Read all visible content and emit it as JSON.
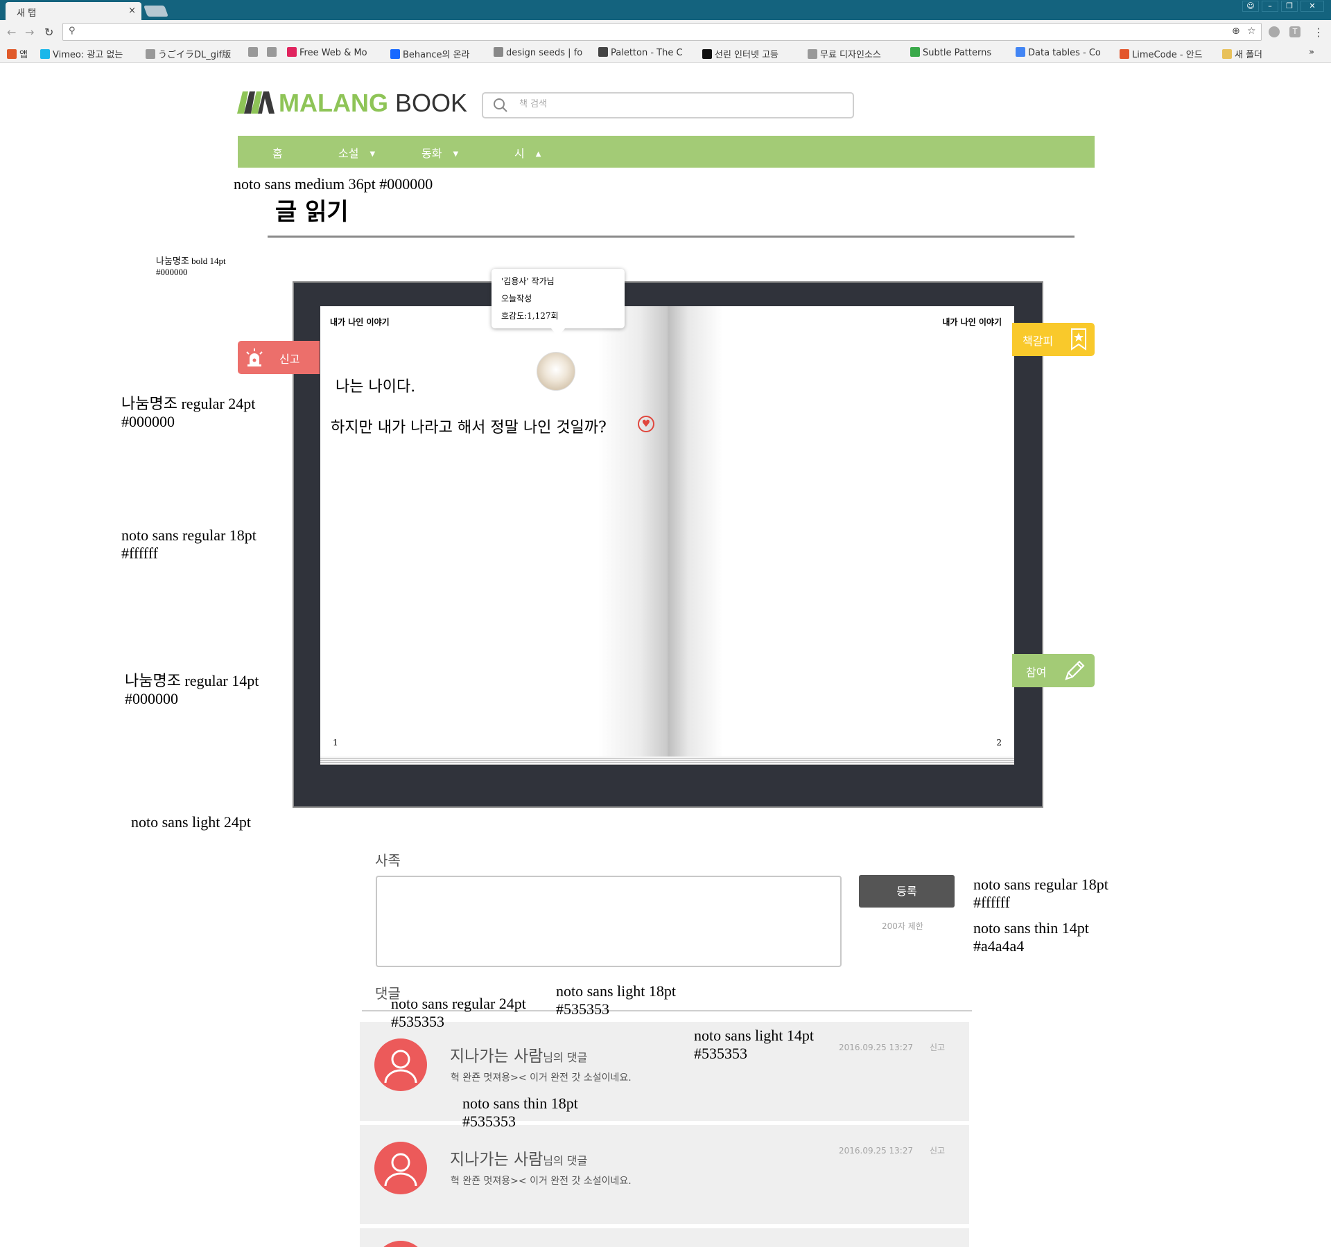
{
  "browser": {
    "tab_title": "새 탭",
    "tab_close": "×",
    "omnibox_value": "",
    "bookmarks": [
      {
        "label": "앱",
        "icon": "apps-grid-icon",
        "color": "#e05a2a"
      },
      {
        "label": "Vimeo: 광고 없는",
        "icon": "vimeo-icon",
        "color": "#1ab7ea"
      },
      {
        "label": "うごイラDL_gif版",
        "icon": "page-icon",
        "color": "#999999"
      },
      {
        "label": "",
        "icon": "page-icon",
        "color": "#999999"
      },
      {
        "label": "",
        "icon": "page-icon",
        "color": "#999999"
      },
      {
        "label": "Free Web & Mo",
        "icon": "invision-icon",
        "color": "#e0245e"
      },
      {
        "label": "Behance의 온라",
        "icon": "behance-icon",
        "color": "#1769ff"
      },
      {
        "label": "design seeds | fo",
        "icon": "design-seeds-icon",
        "color": "#888888"
      },
      {
        "label": "Paletton - The C",
        "icon": "paletton-icon",
        "color": "#444444"
      },
      {
        "label": "선린 인터넷 고등",
        "icon": "sunrin-icon",
        "color": "#111111"
      },
      {
        "label": "무료 디자인소스",
        "icon": "page-icon",
        "color": "#999999"
      },
      {
        "label": "Subtle Patterns",
        "icon": "subtle-patterns-icon",
        "color": "#3aa94a"
      },
      {
        "label": "Data tables - Co",
        "icon": "google-icon",
        "color": "#4285f4"
      },
      {
        "label": "LimeCode - 안드",
        "icon": "limecode-icon",
        "color": "#e3562c"
      },
      {
        "label": "새 폴더",
        "icon": "folder-icon",
        "color": "#e8c15a"
      }
    ],
    "more_bookmarks": "»"
  },
  "site": {
    "logo_brand": "MALANG",
    "logo_word": "BOOK",
    "search_placeholder": "책 검색",
    "nav": [
      {
        "label": "홈",
        "caret": ""
      },
      {
        "label": "소설",
        "caret": "▼"
      },
      {
        "label": "동화",
        "caret": "▼"
      },
      {
        "label": "시",
        "caret": "▲"
      }
    ],
    "colors": {
      "green": "#a3cb76",
      "red": "#ec6f6b",
      "yellow": "#f9c92b",
      "frame": "#30333b",
      "text_gray": "#535353",
      "light_gray": "#a4a4a4"
    }
  },
  "notes": {
    "n1": "noto sans medium 36pt #000000",
    "n2a": "나눔명조 bold 14pt",
    "n2b": "#000000",
    "n3a": "나눔명조 regular 24pt",
    "n3b": "#000000",
    "n4a": "noto sans regular 18pt",
    "n4b": "#ffffff",
    "n5a": "나눔명조 regular 14pt",
    "n5b": "#000000",
    "n6": "noto sans light 24pt",
    "n7a": "noto sans regular 18pt",
    "n7b": "#ffffff",
    "n8a": "noto sans thin 14pt",
    "n8b": "#a4a4a4",
    "n9a": "noto sans regular 24pt",
    "n9b": "#535353",
    "n10a": "noto sans light 18pt",
    "n10b": "#535353",
    "n11a": "noto sans light 14pt",
    "n11b": "#535353",
    "n12a": "noto sans thin 18pt",
    "n12b": "#535353"
  },
  "read": {
    "page_title": "글 읽기",
    "tooltip": {
      "line1": "'김용사' 작가님",
      "line2": "오늘작성",
      "line3": "호감도:1,127회"
    },
    "left_page": {
      "head": "내가 나인 이야기",
      "line1": "나는 나이다.",
      "line2": "하지만 내가 나라고 해서 정말 나인 것일까?",
      "number": "1"
    },
    "right_page": {
      "head": "내가 나인 이야기",
      "number": "2"
    },
    "report_btn": "신고",
    "bookmark_btn": "책갈피",
    "join_btn": "참여"
  },
  "form": {
    "label": "사족",
    "value": "",
    "submit": "등록",
    "limit": "200자 제한"
  },
  "comments": {
    "title": "댓글",
    "items": [
      {
        "name": "지나가는 사람",
        "suffix": "님의 댓글",
        "body": "헉 완죤 멋져용>< 이거 완전 갓 소설이네요.",
        "date": "2016.09.25   13:27",
        "report": "신고"
      },
      {
        "name": "지나가는 사람",
        "suffix": "님의 댓글",
        "body": "헉 완죤 멋져용>< 이거 완전 갓 소설이네요.",
        "date": "2016.09.25   13:27",
        "report": "신고"
      }
    ]
  }
}
